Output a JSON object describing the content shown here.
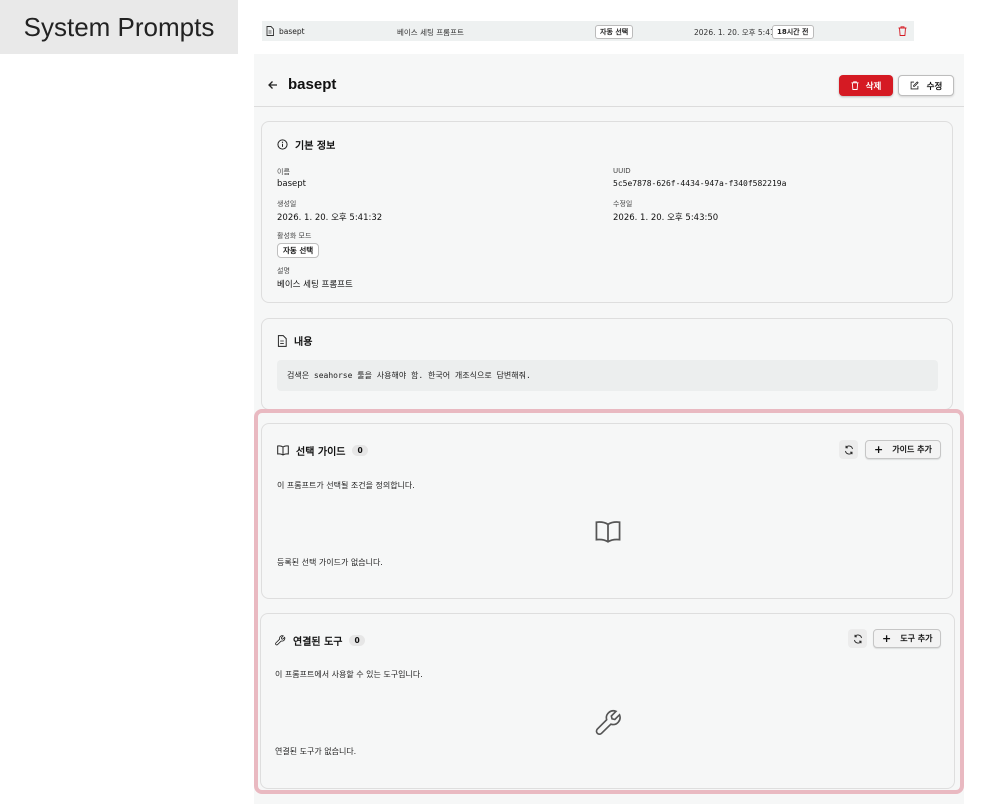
{
  "label": "System Prompts",
  "mini": {
    "name": "basept",
    "desc": "베이스 세팅 프롬프트",
    "mode": "자동 선택",
    "date": "2026. 1. 20. 오후 5:41:32",
    "ago": "18시간 전"
  },
  "header": {
    "title": "basept",
    "delete": "삭제",
    "edit": "수정"
  },
  "info": {
    "title": "기본 정보",
    "name_label": "이름",
    "name": "basept",
    "uuid_label": "UUID",
    "uuid": "5c5e7878-626f-4434-947a-f340f582219a",
    "created_label": "생성일",
    "created": "2026. 1. 20. 오후 5:41:32",
    "updated_label": "수정일",
    "updated": "2026. 1. 20. 오후 5:43:50",
    "mode_label": "활성화 모드",
    "mode": "자동 선택",
    "desc_label": "설명",
    "desc": "베이스 세팅 프롬프트"
  },
  "content": {
    "title": "내용",
    "body": "검색은 seahorse 툴을 사용해야 함. 한국어 개조식으로 답변해줘."
  },
  "guide": {
    "title": "선택 가이드",
    "count": "0",
    "add": "가이드 추가",
    "desc": "이 프롬프트가 선택될 조건을 정의합니다.",
    "empty": "등록된 선택 가이드가 없습니다."
  },
  "tools": {
    "title": "연결된 도구",
    "count": "0",
    "add": "도구 추가",
    "desc": "이 프롬프트에서 사용할 수 있는 도구입니다.",
    "empty": "연결된 도구가 없습니다."
  },
  "colors": {
    "accent_red": "#d51a23",
    "highlight": "#e9b9c1"
  },
  "icons": [
    "document-icon",
    "trash-icon",
    "back-arrow-icon",
    "edit-icon",
    "info-icon",
    "book-icon",
    "refresh-icon",
    "plus-icon",
    "wrench-icon"
  ]
}
